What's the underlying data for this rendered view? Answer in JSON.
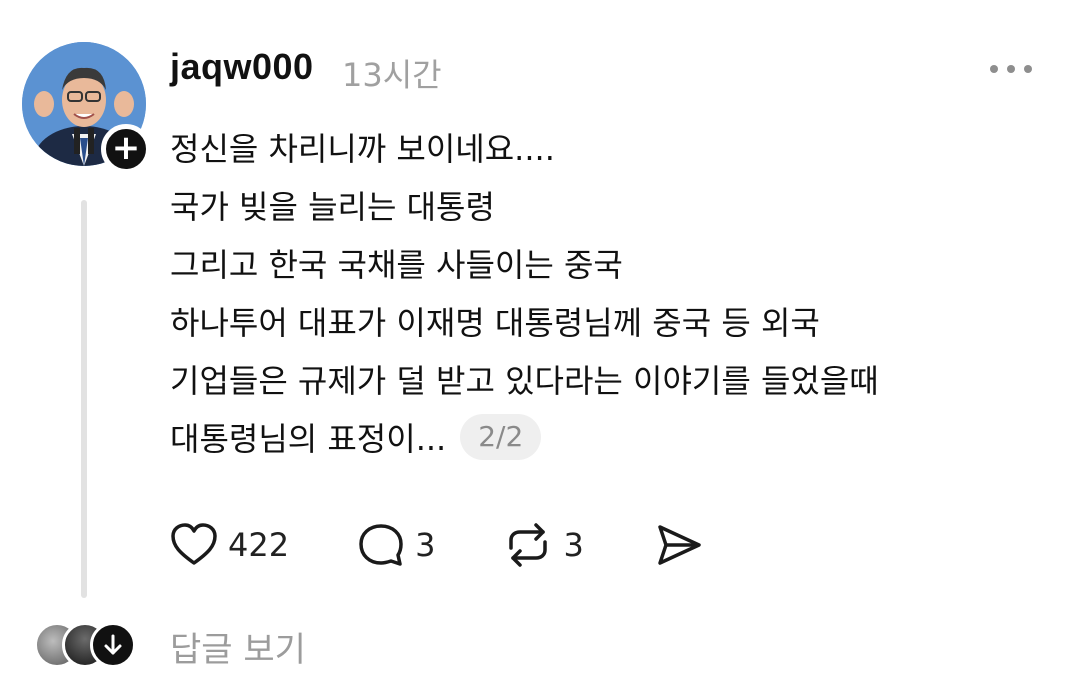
{
  "post": {
    "username": "jaqw000",
    "time": "13시간",
    "lines": [
      "정신을 차리니까 보이네요....",
      "국가 빚을 늘리는 대통령",
      "그리고 한국 국채를 사들이는 중국",
      "하나투어 대표가 이재명 대통령님께 중국 등 외국",
      "기업들은 규제가 덜 받고 있다라는 이야기를 들었을때",
      "대통령님의 표정이..."
    ],
    "page_indicator": "2/2"
  },
  "actions": {
    "likes": "422",
    "comments": "3",
    "reposts": "3"
  },
  "replies": {
    "label": "답글 보기"
  },
  "icons": {
    "avatar": "profile-photo",
    "follow": "plus-icon",
    "more": "more-options-icon",
    "like": "heart-icon",
    "comment": "comment-bubble-icon",
    "repost": "repost-icon",
    "share": "send-icon",
    "expand": "arrow-down-icon"
  },
  "colors": {
    "text": "#111111",
    "muted": "#a0a0a0",
    "badge_bg": "#efefef",
    "thread_line": "#e2e2e2"
  }
}
